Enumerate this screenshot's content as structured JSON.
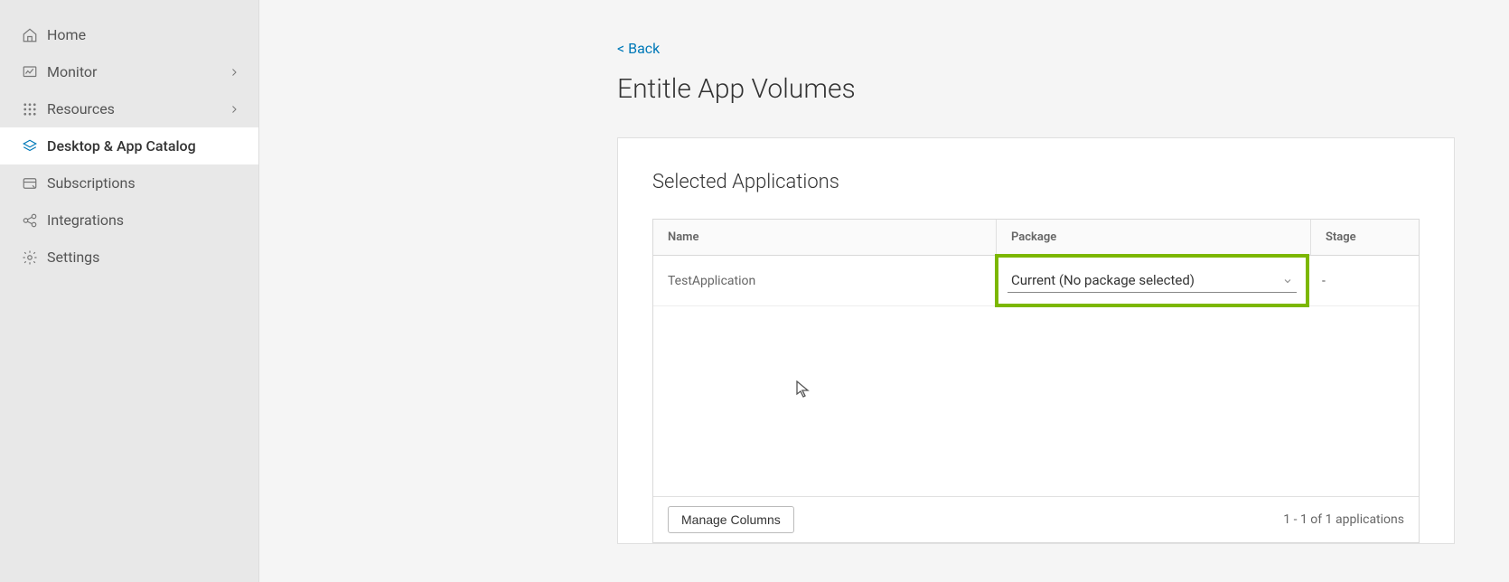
{
  "sidebar": {
    "items": [
      {
        "label": "Home",
        "icon": "home",
        "expandable": false,
        "active": false
      },
      {
        "label": "Monitor",
        "icon": "monitor",
        "expandable": true,
        "active": false
      },
      {
        "label": "Resources",
        "icon": "resources",
        "expandable": true,
        "active": false
      },
      {
        "label": "Desktop & App Catalog",
        "icon": "catalog",
        "expandable": false,
        "active": true
      },
      {
        "label": "Subscriptions",
        "icon": "subscriptions",
        "expandable": false,
        "active": false
      },
      {
        "label": "Integrations",
        "icon": "integrations",
        "expandable": false,
        "active": false
      },
      {
        "label": "Settings",
        "icon": "settings",
        "expandable": false,
        "active": false
      }
    ]
  },
  "page": {
    "back_label": "< Back",
    "title": "Entitle App Volumes",
    "section_title": "Selected Applications"
  },
  "table": {
    "columns": {
      "name": "Name",
      "package": "Package",
      "stage": "Stage"
    },
    "rows": [
      {
        "name": "TestApplication",
        "package": "Current (No package selected)",
        "stage": "-"
      }
    ],
    "footer": {
      "manage_columns": "Manage Columns",
      "count_text": "1 - 1 of 1 applications"
    }
  }
}
